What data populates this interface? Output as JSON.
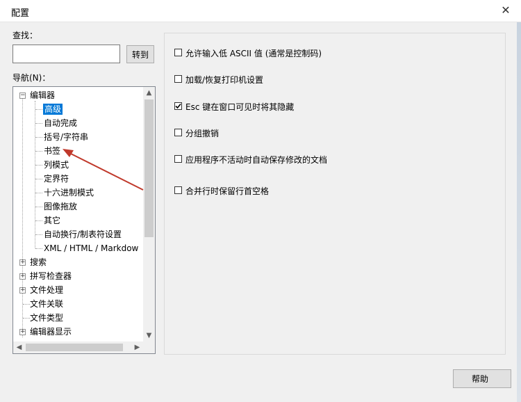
{
  "window": {
    "title": "配置",
    "close_glyph": "✕"
  },
  "find": {
    "label": "查找：",
    "value": "",
    "placeholder": "",
    "goto_label": "转到"
  },
  "nav": {
    "label": "导航(N)：",
    "tree": [
      {
        "label": "编辑器",
        "expander": "−"
      },
      {
        "label": "高级",
        "selected": true
      },
      {
        "label": "自动完成"
      },
      {
        "label": "括号/字符串"
      },
      {
        "label": "书签"
      },
      {
        "label": "列模式"
      },
      {
        "label": "定界符"
      },
      {
        "label": "十六进制模式"
      },
      {
        "label": "图像拖放"
      },
      {
        "label": "其它"
      },
      {
        "label": "自动换行/制表符设置"
      },
      {
        "label": "XML / HTML / Markdow"
      },
      {
        "label": "搜索",
        "expander": "+"
      },
      {
        "label": "拼写检查器",
        "expander": "+"
      },
      {
        "label": "文件处理",
        "expander": "+"
      },
      {
        "label": "文件关联"
      },
      {
        "label": "文件类型"
      },
      {
        "label": "编辑器显示",
        "expander": "+"
      }
    ]
  },
  "options": [
    {
      "label": "允许输入低 ASCII 值 (通常是控制码)",
      "checked": false
    },
    {
      "label": "加载/恢复打印机设置",
      "checked": false
    },
    {
      "label": "Esc 键在窗口可见时将其隐藏",
      "checked": true
    },
    {
      "label": "分组撤销",
      "checked": false
    },
    {
      "label": "应用程序不活动时自动保存修改的文档",
      "checked": false
    },
    {
      "label": "合并行时保留行首空格",
      "checked": false
    }
  ],
  "help_label": "帮助",
  "colors": {
    "selection": "#0078d7",
    "annotation_arrow": "#c0392b"
  }
}
